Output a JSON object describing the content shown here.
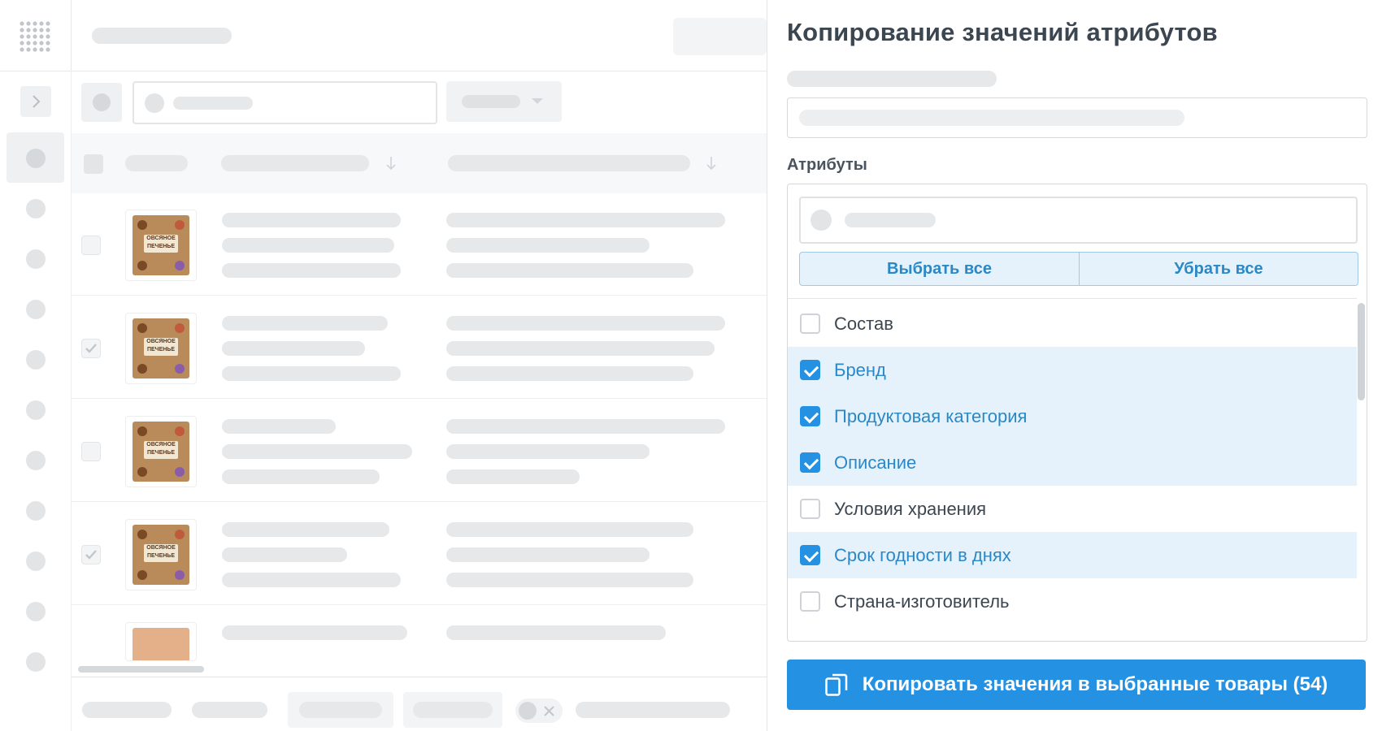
{
  "panel": {
    "title": "Копирование значений атрибутов",
    "attributes_label": "Атрибуты",
    "select_all": "Выбрать все",
    "clear_all": "Убрать все",
    "items": [
      {
        "label": "Состав",
        "checked": false
      },
      {
        "label": "Бренд",
        "checked": true
      },
      {
        "label": "Продуктовая категория",
        "checked": true
      },
      {
        "label": "Описание",
        "checked": true
      },
      {
        "label": "Условия хранения",
        "checked": false
      },
      {
        "label": "Срок годности в днях",
        "checked": true
      },
      {
        "label": "Страна-изготовитель",
        "checked": false
      }
    ],
    "copy_button": "Копировать значения в выбранные товары (54)"
  },
  "products": {
    "label_text": "ОВСЯНОЕ ПЕЧЕНЬЕ",
    "rows": [
      {
        "checked": false
      },
      {
        "checked": true
      },
      {
        "checked": false
      },
      {
        "checked": true
      }
    ]
  },
  "icons": {
    "apps": "apps-grid-icon",
    "expand": "chevron-right-icon",
    "copy": "copy-icon",
    "sort": "sort-down-icon"
  },
  "colors": {
    "accent": "#2491e3",
    "selected_row": "#e6f2fb",
    "skeleton": "#e6e8ea"
  }
}
